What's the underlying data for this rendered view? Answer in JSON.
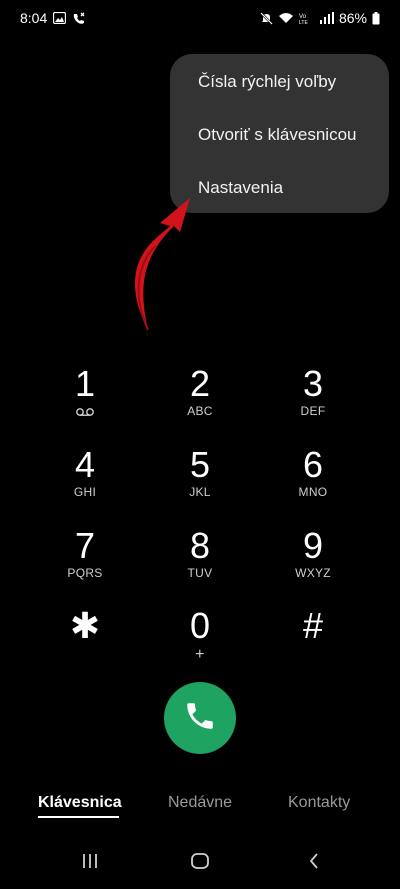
{
  "status_bar": {
    "time": "8:04",
    "battery": "86%",
    "left_icons": [
      "gallery-icon",
      "missed-call-icon"
    ],
    "right_icons": [
      "mute-icon",
      "wifi-icon",
      "volte-icon",
      "signal-icon",
      "battery-icon"
    ]
  },
  "menu": {
    "items": [
      "Čísla rýchlej voľby",
      "Otvoriť s klávesnicou",
      "Nastavenia"
    ]
  },
  "keypad": {
    "keys": [
      {
        "digit": "1",
        "letters": "",
        "sub_icon": "voicemail-icon"
      },
      {
        "digit": "2",
        "letters": "ABC"
      },
      {
        "digit": "3",
        "letters": "DEF"
      },
      {
        "digit": "4",
        "letters": "GHI"
      },
      {
        "digit": "5",
        "letters": "JKL"
      },
      {
        "digit": "6",
        "letters": "MNO"
      },
      {
        "digit": "7",
        "letters": "PQRS"
      },
      {
        "digit": "8",
        "letters": "TUV"
      },
      {
        "digit": "9",
        "letters": "WXYZ"
      },
      {
        "digit": "✱",
        "letters": ""
      },
      {
        "digit": "0",
        "letters": "+"
      },
      {
        "digit": "#",
        "letters": ""
      }
    ]
  },
  "call_button": {
    "icon": "phone-icon",
    "color": "#1fa361"
  },
  "tabs": {
    "items": [
      "Klávesnica",
      "Nedávne",
      "Kontakty"
    ],
    "active": "Klávesnica"
  },
  "nav_bar": {
    "buttons": [
      "recents-icon",
      "home-icon",
      "back-icon"
    ]
  },
  "colors": {
    "background": "#000000",
    "menu_bg": "#333333",
    "accent_arrow": "#d3131c"
  }
}
